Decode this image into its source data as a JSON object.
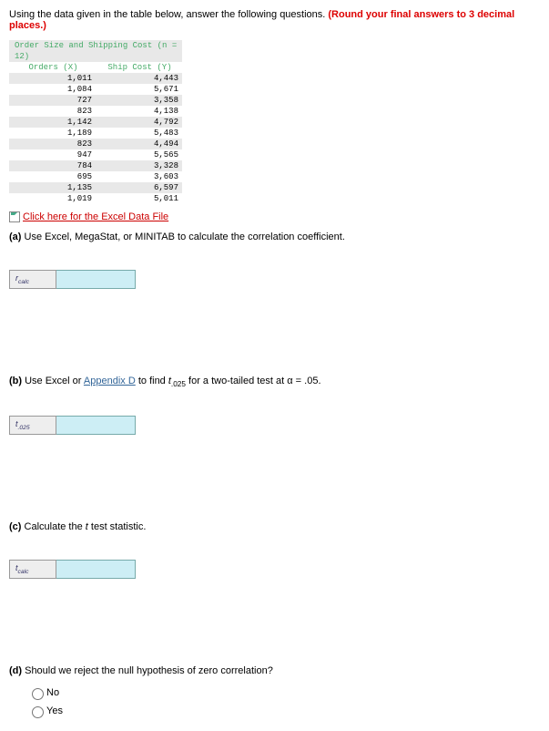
{
  "intro": {
    "text": "Using the data given in the table below, answer the following questions. ",
    "round_note": "(Round your final answers to 3 decimal places.)"
  },
  "table": {
    "title": "Order Size and Shipping Cost (n = 12)",
    "col1": "Orders (X)",
    "col2": "Ship Cost (Y)",
    "rows": [
      {
        "x": "1,011",
        "y": "4,443"
      },
      {
        "x": "1,084",
        "y": "5,671"
      },
      {
        "x": "727",
        "y": "3,358"
      },
      {
        "x": "823",
        "y": "4,138"
      },
      {
        "x": "1,142",
        "y": "4,792"
      },
      {
        "x": "1,189",
        "y": "5,483"
      },
      {
        "x": "823",
        "y": "4,494"
      },
      {
        "x": "947",
        "y": "5,565"
      },
      {
        "x": "784",
        "y": "3,328"
      },
      {
        "x": "695",
        "y": "3,603"
      },
      {
        "x": "1,135",
        "y": "6,597"
      },
      {
        "x": "1,019",
        "y": "5,011"
      }
    ]
  },
  "excel_link": "Click here for the Excel Data File",
  "qa": {
    "label": "(a)",
    "text": " Use Excel, MegaStat, or MINITAB to calculate the correlation coefficient.",
    "input_label": "rcalc"
  },
  "qb": {
    "label": "(b)",
    "pre": " Use Excel or ",
    "link": "Appendix D",
    "post1": " to find ",
    "tvar": "t",
    "tsub": ".025",
    "post2": " for a two-tailed test at α = .05.",
    "input_label": "t.025"
  },
  "qc": {
    "label": "(c)",
    "pre": " Calculate the ",
    "tvar": "t",
    "post": " test statistic.",
    "input_label": "tcalc"
  },
  "qd": {
    "label": "(d)",
    "text": " Should we reject the null hypothesis of zero correlation?",
    "opt_no": "No",
    "opt_yes": "Yes"
  },
  "chart_data": {
    "type": "table",
    "title": "Order Size and Shipping Cost (n = 12)",
    "columns": [
      "Orders (X)",
      "Ship Cost (Y)"
    ],
    "data": [
      [
        1011,
        4443
      ],
      [
        1084,
        5671
      ],
      [
        727,
        3358
      ],
      [
        823,
        4138
      ],
      [
        1142,
        4792
      ],
      [
        1189,
        5483
      ],
      [
        823,
        4494
      ],
      [
        947,
        5565
      ],
      [
        784,
        3328
      ],
      [
        695,
        3603
      ],
      [
        1135,
        6597
      ],
      [
        1019,
        5011
      ]
    ]
  }
}
